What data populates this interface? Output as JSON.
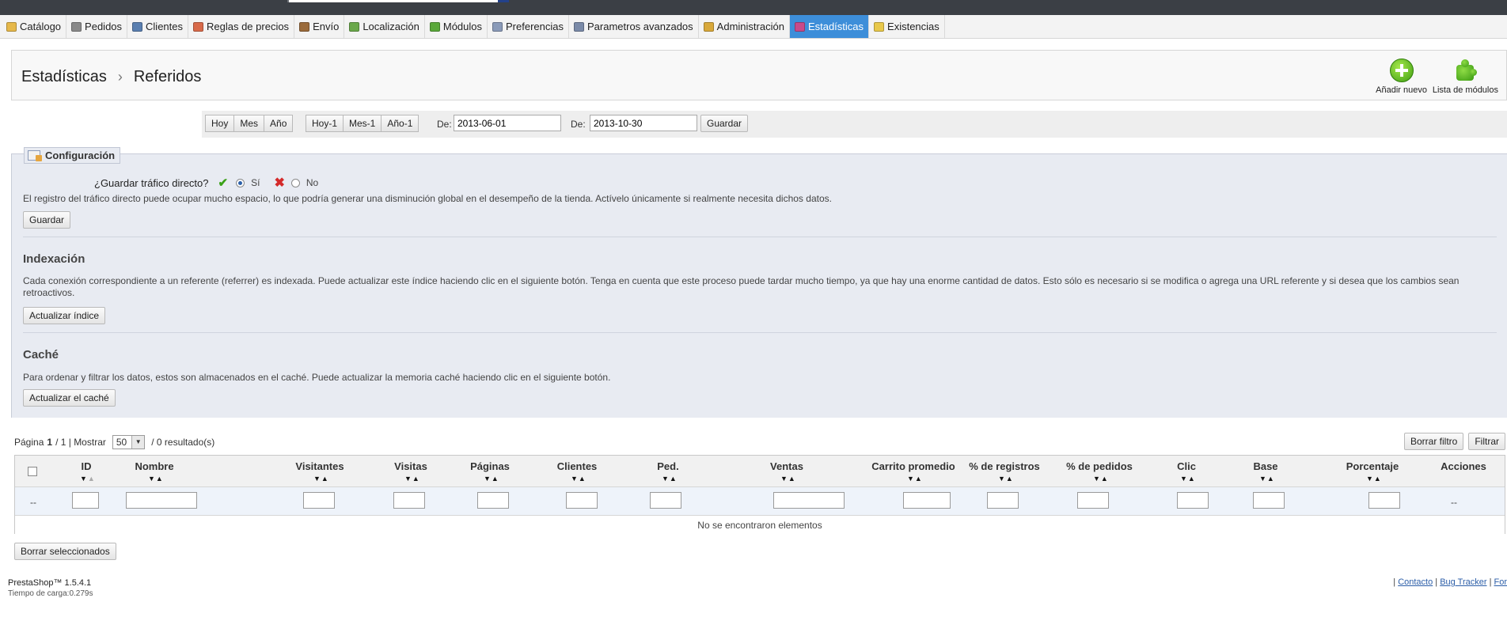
{
  "menu": {
    "items": [
      {
        "label": "Catálogo",
        "color": "#e6b84a"
      },
      {
        "label": "Pedidos",
        "color": "#8a8a8a"
      },
      {
        "label": "Clientes",
        "color": "#5a7fb0"
      },
      {
        "label": "Reglas de precios",
        "color": "#d86a4a"
      },
      {
        "label": "Envío",
        "color": "#9a6a3a"
      },
      {
        "label": "Localización",
        "color": "#6aa84a"
      },
      {
        "label": "Módulos",
        "color": "#5aa83a"
      },
      {
        "label": "Preferencias",
        "color": "#8a9ab8"
      },
      {
        "label": "Parametros avanzados",
        "color": "#7a8aa8"
      },
      {
        "label": "Administración",
        "color": "#d8a83a"
      },
      {
        "label": "Estadísticas",
        "color": "#c84a8a"
      },
      {
        "label": "Existencias",
        "color": "#e8c84a"
      }
    ],
    "active_index": 10,
    "active_color": "#3d8ed9"
  },
  "header": {
    "breadcrumb_parent": "Estadísticas",
    "breadcrumb_sep": "›",
    "title": "Referidos",
    "add_new_label": "Añadir nuevo",
    "module_list_label": "Lista de módulos"
  },
  "date_bar": {
    "period_buttons": [
      "Hoy",
      "Mes",
      "Año"
    ],
    "previous_buttons": [
      "Hoy-1",
      "Mes-1",
      "Año-1"
    ],
    "from_label": "De:",
    "from_value": "2013-06-01",
    "to_label": "De:",
    "to_value": "2013-10-30",
    "save_label": "Guardar"
  },
  "config": {
    "legend": "Configuración",
    "direct_traffic_label": "¿Guardar tráfico directo?",
    "yes_label": "Sí",
    "no_label": "No",
    "direct_traffic_enabled": true,
    "direct_traffic_help": "El registro del tráfico directo puede ocupar mucho espacio, lo que podría generar una disminución global en el desempeño de la tienda. Actívelo únicamente si realmente necesita dichos datos.",
    "save_label": "Guardar",
    "indexation_title": "Indexación",
    "indexation_text": "Cada conexión correspondiente a un referente (referrer) es indexada. Puede actualizar este índice haciendo clic en el siguiente botón. Tenga en cuenta que este proceso puede tardar mucho tiempo, ya que hay una enorme cantidad de datos. Esto sólo es necesario si se modifica o agrega una URL referente y si desea que los cambios sean retroactivos.",
    "update_index_label": "Actualizar índice",
    "cache_title": "Caché",
    "cache_text": "Para ordenar y filtrar los datos, estos son almacenados en el caché. Puede actualizar la memoria caché haciendo clic en el siguiente botón.",
    "update_cache_label": "Actualizar el caché"
  },
  "list": {
    "page_prefix": "Página",
    "page_current": "1",
    "page_total": "/ 1 | Mostrar",
    "per_page": "50",
    "results": "/ 0 resultado(s)",
    "clear_filter_label": "Borrar filtro",
    "filter_label": "Filtrar",
    "columns": [
      "ID",
      "Nombre",
      "Visitantes",
      "Visitas",
      "Páginas",
      "Clientes",
      "Ped.",
      "Ventas",
      "Carrito promedio",
      "% de registros",
      "% de pedidos",
      "Clic",
      "Base",
      "Porcentaje",
      "Acciones"
    ],
    "filter_dash": "--",
    "actions_dash": "--",
    "empty_message": "No se encontraron elementos",
    "delete_selected_label": "Borrar seleccionados"
  },
  "footer": {
    "version": "PrestaShop™ 1.5.4.1",
    "load_time": "Tiempo de carga:0.279s",
    "sep": "|",
    "contact": "Contacto",
    "bug_tracker": "Bug Tracker",
    "forum": "For"
  }
}
